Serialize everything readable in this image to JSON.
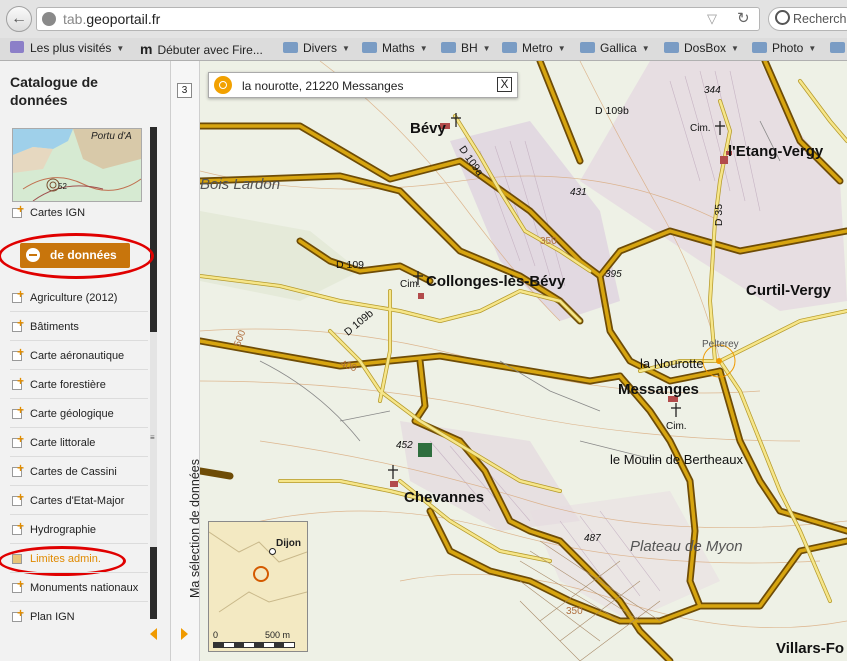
{
  "browser": {
    "url_prefix": "tab.",
    "url_domain": "geoportail.fr",
    "search_placeholder": "Recherch",
    "bookmarks": [
      {
        "label": "Les plus visités",
        "icon": "most-visited-icon",
        "caret": true
      },
      {
        "label": "Débuter avec Fire...",
        "icon": "firefox-m-icon",
        "caret": false
      },
      {
        "label": "Divers",
        "icon": "folder-icon",
        "caret": true
      },
      {
        "label": "Maths",
        "icon": "folder-icon",
        "caret": true
      },
      {
        "label": "BH",
        "icon": "folder-icon",
        "caret": true
      },
      {
        "label": "Metro",
        "icon": "folder-icon",
        "caret": true
      },
      {
        "label": "Gallica",
        "icon": "folder-icon",
        "caret": true
      },
      {
        "label": "DosBox",
        "icon": "folder-icon",
        "caret": true
      },
      {
        "label": "Photo",
        "icon": "folder-icon",
        "caret": true
      }
    ]
  },
  "sidebar": {
    "title": "Catalogue de données",
    "thumb_label": "Portu d'A",
    "thumb_number": "52",
    "first_item": "Cartes IGN",
    "button_label": "de données",
    "items": [
      "Agriculture (2012)",
      "Bâtiments",
      "Carte aéronautique",
      "Carte forestière",
      "Carte géologique",
      "Carte littorale",
      "Cartes de Cassini",
      "Cartes d'Etat-Major",
      "Hydrographie",
      "Limites admin.",
      "Monuments nationaux",
      "Plan IGN"
    ],
    "highlighted_item": "Limites admin.",
    "accent_color": "#c8750c",
    "annotation_color": "#e00000"
  },
  "panel": {
    "count": "3",
    "vertical_label": "Ma sélection de données"
  },
  "map": {
    "search_text": "la nourotte, 21220 Messanges",
    "close_label": "X",
    "labels": {
      "bevy": "Bévy",
      "etang": "l'Etang-Vergy",
      "collonges": "Collonges-lès-Bévy",
      "curtil": "Curtil-Vergy",
      "messanges": "Messanges",
      "nourotte": "la Nourotte",
      "pelterey": "Pelterey",
      "moulin": "le Moulin de Bertheaux",
      "chevannes": "Chevannes",
      "plateau": "Plateau de Myon",
      "villars": "Villars-Fo",
      "bois": "Bois Lardon",
      "d109b_top": "D 109b",
      "d109a": "D 109a",
      "d109": "D 109",
      "d109b_left": "D 109b",
      "d35": "D 35",
      "cim": "Cim.",
      "n344": "344",
      "n431": "431",
      "n350": "350",
      "n395": "395",
      "n452": "452",
      "n487": "487",
      "n500": "500",
      "n400": "400",
      "n350b": "350"
    },
    "minimap": {
      "city": "Dijon",
      "scale_start": "0",
      "scale_end": "500 m"
    }
  }
}
